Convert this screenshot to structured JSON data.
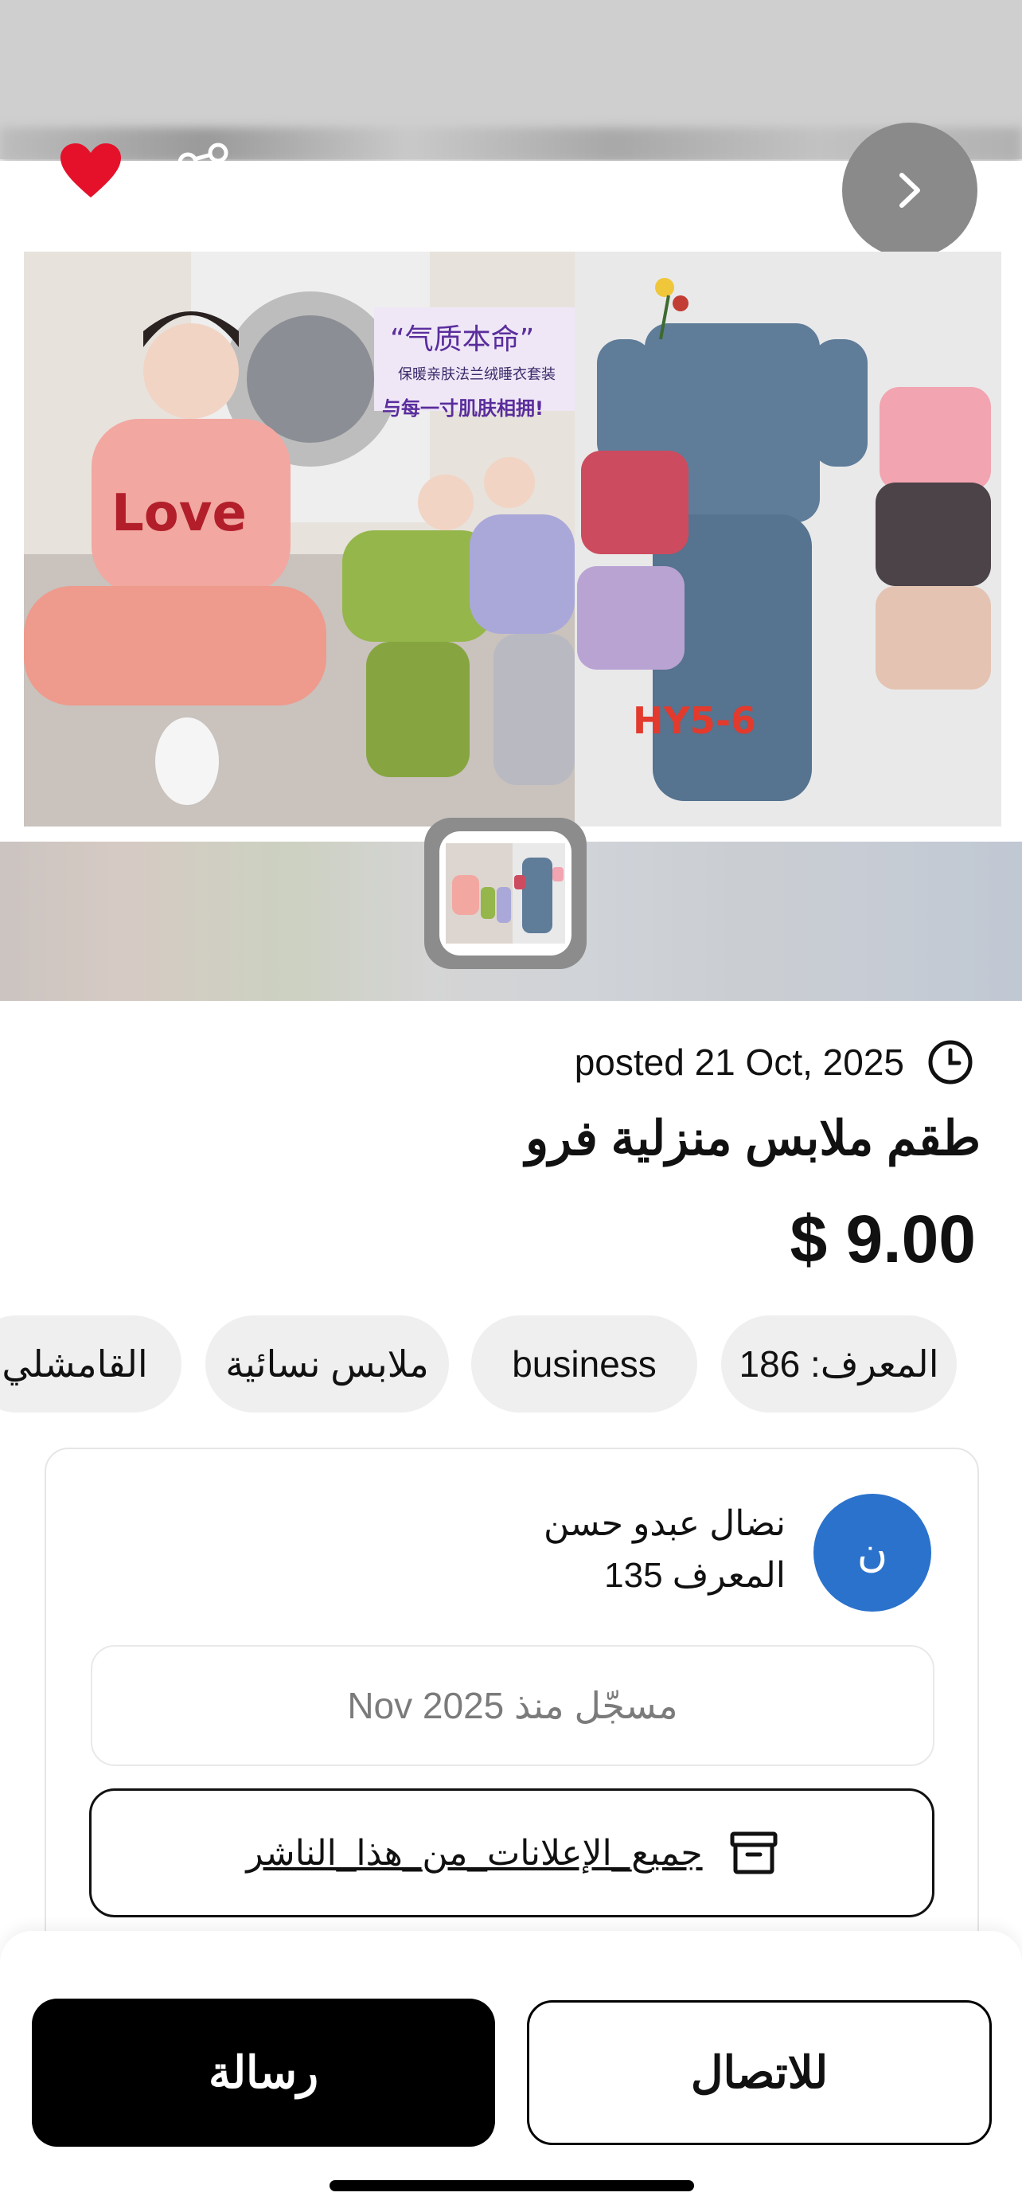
{
  "listing": {
    "posted": "posted 21 Oct, 2025",
    "title": "طقم ملابس منزلية فرو",
    "price": "$ 9.00"
  },
  "tags": [
    "المعرف: 186",
    "business",
    "ملابس نسائية",
    "القامشلي"
  ],
  "seller": {
    "avatar_initial": "ن",
    "name": "نضال عبدو حسن",
    "id_label": "المعرف 135",
    "registered": "مسجّل منذ Nov 2025",
    "all_ads_label": "جميع_الإعلانات_من_هذا_الناشر"
  },
  "actions": {
    "call_label": "للاتصال",
    "message_label": "رسالة"
  },
  "product_image": {
    "badges": [
      "Love",
      "HY5-6",
      "“气质本命”",
      "保暖亲肤法兰绒睡衣套装",
      "与每一寸肌肤相拥!"
    ]
  },
  "icons": {
    "favorite": "heart-icon",
    "share": "share-icon",
    "next": "chevron-right-icon",
    "posted": "clock-icon",
    "all_ads": "archive-icon"
  },
  "colors": {
    "favorite": "#e5112a",
    "avatar": "#2a72cc",
    "primary_button": "#000000",
    "tag_bg": "#efefef"
  }
}
